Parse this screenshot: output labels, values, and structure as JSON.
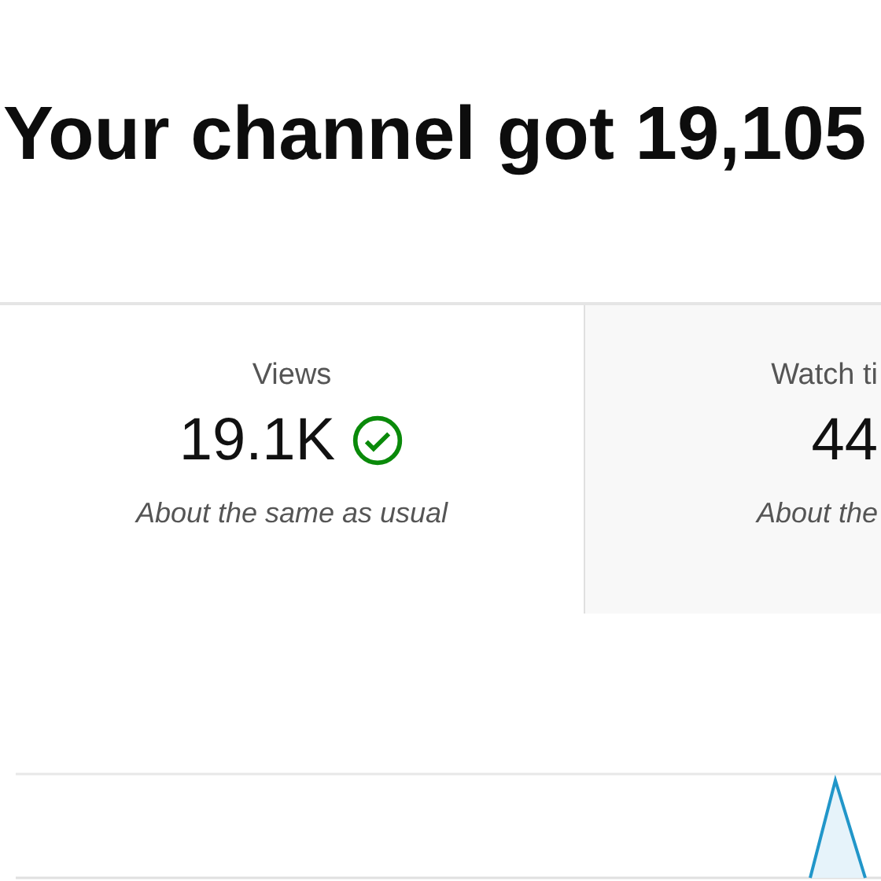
{
  "headline": "Your channel got 19,105",
  "metrics": [
    {
      "label": "Views",
      "value": "19.1K",
      "verified": true,
      "note": "About the same as usual",
      "selected": true
    },
    {
      "label": "Watch ti",
      "value": "44",
      "note": "About the",
      "verified": false,
      "selected": false
    }
  ]
}
